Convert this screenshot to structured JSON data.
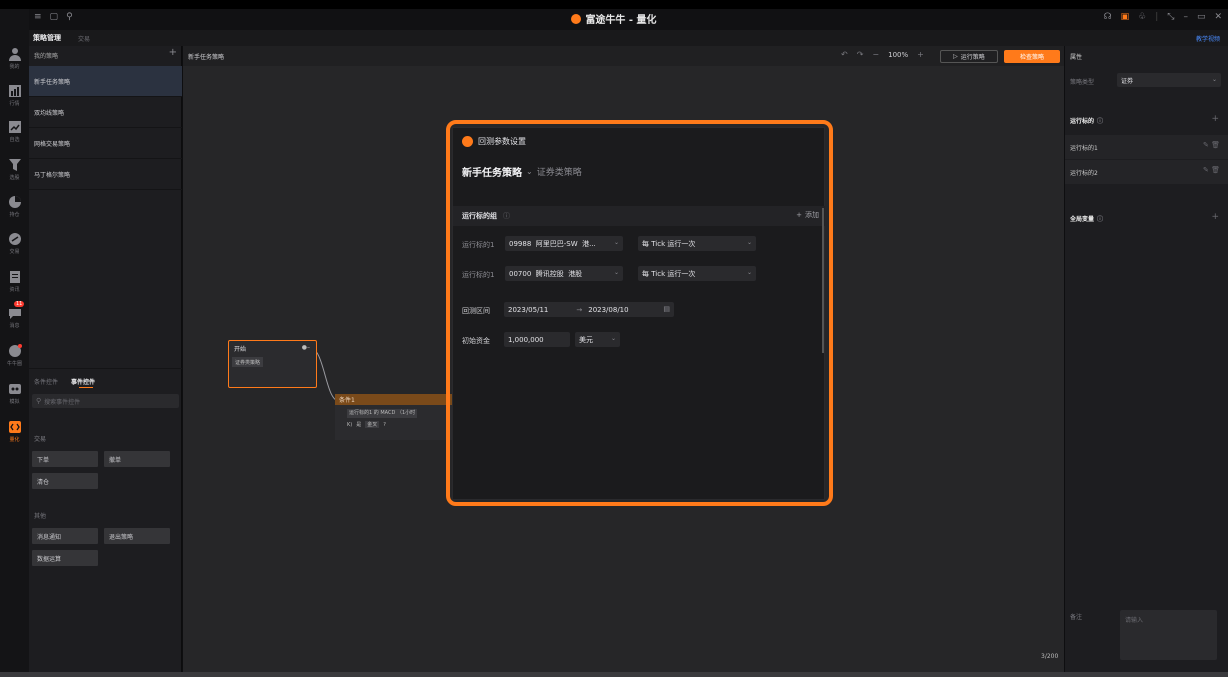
{
  "window": {
    "title": "富途牛牛 - 量化"
  },
  "rail": {
    "items": [
      {
        "icon": "user-icon",
        "label": "我的"
      },
      {
        "icon": "market-icon",
        "label": "行情"
      },
      {
        "icon": "trend-icon",
        "label": "自选"
      },
      {
        "icon": "filter-icon",
        "label": "选股"
      },
      {
        "icon": "pie-icon",
        "label": "持仓"
      },
      {
        "icon": "trade-icon",
        "label": "交易"
      },
      {
        "icon": "news-icon",
        "label": "资讯"
      },
      {
        "icon": "chat-icon",
        "label": "消息",
        "badge": "11"
      },
      {
        "icon": "discover-icon",
        "label": "牛牛圈"
      },
      {
        "icon": "game-icon",
        "label": "模拟"
      },
      {
        "icon": "quant-icon",
        "label": "量化"
      }
    ]
  },
  "tabs": {
    "active": "策略管理",
    "other": "交易",
    "tutorial": "教学视频"
  },
  "left": {
    "header": "我的策略",
    "strategies": [
      "新手任务策略",
      "双均线策略",
      "网格交易策略",
      "马丁格尔策略"
    ],
    "control_tabs": [
      "条件控件",
      "事件控件"
    ],
    "search_placeholder": "搜索事件控件",
    "group_trade": "交易",
    "trade_buttons": [
      "下单",
      "撤单",
      "清仓"
    ],
    "group_other": "其他",
    "other_buttons": [
      "消息通知",
      "退出策略",
      "数据运算"
    ]
  },
  "canvas": {
    "title": "新手任务策略",
    "zoom": "100%",
    "run_button": "运行策略",
    "check_button": "检查策略",
    "page_counter": "3/200",
    "start_node": {
      "title": "开始",
      "tag": "证券类策略"
    },
    "condition_node": {
      "title": "条件1",
      "line1": "运行标的1 的 MACD （1小时",
      "k": "K)",
      "is": "是",
      "gold": "金叉",
      "q": "?"
    }
  },
  "right": {
    "header": "属性",
    "strategy_type_label": "策略类型",
    "strategy_type_value": "证券",
    "targets_header": "运行标的",
    "targets": [
      "运行标的1",
      "运行标的2"
    ],
    "globals_header": "全局变量",
    "note_label": "备注",
    "note_placeholder": "请输入"
  },
  "modal": {
    "title": "回测参数设置",
    "strategy_name": "新手任务策略",
    "strategy_type": "证券类策略",
    "group_label": "运行标的组",
    "add_label": "添加",
    "rows": [
      {
        "label": "运行标的1",
        "code": "09988",
        "name": "阿里巴巴-SW",
        "market": "港...",
        "freq": "每 Tick 运行一次"
      },
      {
        "label": "运行标的1",
        "code": "00700",
        "name": "腾讯控股",
        "market": "港股",
        "freq": "每 Tick 运行一次"
      }
    ],
    "range_label": "回测区间",
    "date_start": "2023/05/11",
    "date_end": "2023/08/10",
    "capital_label": "初始资金",
    "capital_value": "1,000,000",
    "currency": "美元"
  },
  "colors": {
    "accent": "#ff7a1a",
    "bg": "#262628",
    "panel": "#1d1d20"
  }
}
